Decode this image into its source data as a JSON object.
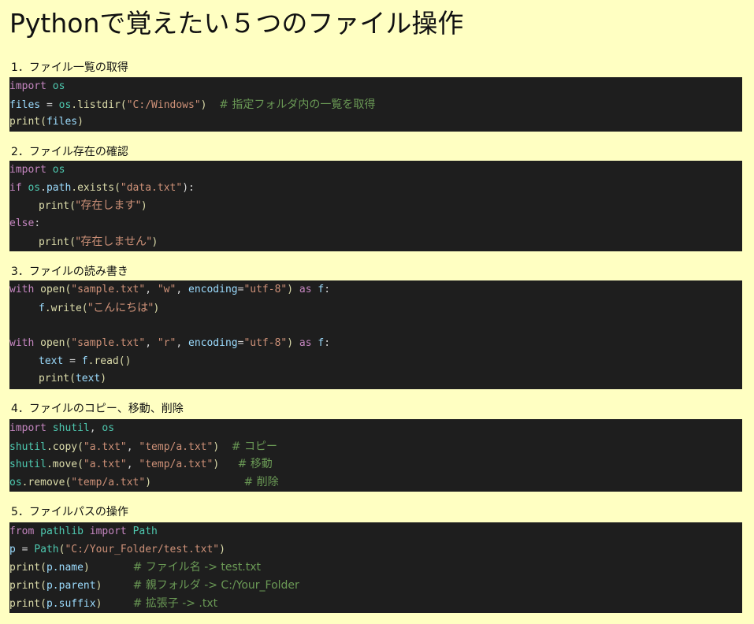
{
  "title": "Pythonで覚えたい５つのファイル操作",
  "sections": [
    {
      "heading": "1．ファイル一覧の取得",
      "code": {
        "import": "import",
        "os": "os",
        "files": "files",
        "eq": " = ",
        "os2": "os",
        "listdir": ".listdir(",
        "path_str": "\"C:/Windows\"",
        "close_paren": ")",
        "comment": "# 指定フォルダ内の一覧を取得",
        "print": "print(",
        "files2": "files",
        "close2": ")"
      }
    },
    {
      "heading": "2．ファイル存在の確認",
      "code": {
        "import": "import",
        "os": "os",
        "if": "if",
        "os2": "os",
        "path": "path",
        "exists": ".exists(",
        "data_str": "\"data.txt\"",
        "close_colon": "):",
        "print1": "print(",
        "str1": "\"存在します\"",
        "close1": ")",
        "else": "else",
        "else_colon": ":",
        "print2": "print(",
        "str2": "\"存在しません\"",
        "close2": ")"
      }
    },
    {
      "heading": "3．ファイルの読み書き",
      "code": {
        "with1": "with",
        "open1": "open(",
        "file1": "\"sample.txt\"",
        "comma1": ", ",
        "mode_w": "\"w\"",
        "comma2": ", ",
        "enc1": "encoding",
        "eq1": "=",
        "utf1": "\"utf-8\"",
        "paren1": ")",
        "as1": "as",
        "f1": "f",
        "colon1": ":",
        "f_write": "f",
        "write": ".write(",
        "hello": "\"こんにちは\"",
        "close_w": ")",
        "with2": "with",
        "open2": "open(",
        "file2": "\"sample.txt\"",
        "comma3": ", ",
        "mode_r": "\"r\"",
        "comma4": ", ",
        "enc2": "encoding",
        "eq2": "=",
        "utf2": "\"utf-8\"",
        "paren2": ")",
        "as2": "as",
        "f2": "f",
        "colon2": ":",
        "text": "text",
        "eq3": " = ",
        "f_read": "f",
        "read": ".read()",
        "print": "print(",
        "text2": "text",
        "close_p": ")"
      }
    },
    {
      "heading": "4．ファイルのコピー、移動、削除",
      "code": {
        "import": "import",
        "shutil": "shutil",
        "comma": ", ",
        "os": "os",
        "shutil1": "shutil",
        "copy": ".copy(",
        "a_txt1": "\"a.txt\"",
        "comma1": ", ",
        "temp1": "\"temp/a.txt\"",
        "close1": ")",
        "c1": "# コピー",
        "shutil2": "shutil",
        "move": ".move(",
        "a_txt2": "\"a.txt\"",
        "comma2": ", ",
        "temp2": "\"temp/a.txt\"",
        "close2": ")",
        "c2": "# 移動",
        "os2": "os",
        "remove": ".remove(",
        "temp3": "\"temp/a.txt\"",
        "close3": ")",
        "c3": "# 削除"
      }
    },
    {
      "heading": "5．ファイルパスの操作",
      "code": {
        "from": "from",
        "pathlib": "pathlib",
        "import": "import",
        "Path": "Path",
        "p": "p",
        "eq": " = ",
        "Path2": "Path",
        "open_p": "(",
        "path_str": "\"C:/Your_Folder/test.txt\"",
        "close_p": ")",
        "print1": "print(",
        "p1": "p",
        "name": ".name",
        "close1": ")",
        "c1": "# ファイル名 -> test.txt",
        "print2": "print(",
        "p2": "p",
        "parent": ".parent",
        "close2": ")",
        "c2": "# 親フォルダ -> C:/Your_Folder",
        "print3": "print(",
        "p3": "p",
        "suffix": ".suffix",
        "close3": ")",
        "c3": "# 拡張子 -> .txt"
      }
    }
  ]
}
